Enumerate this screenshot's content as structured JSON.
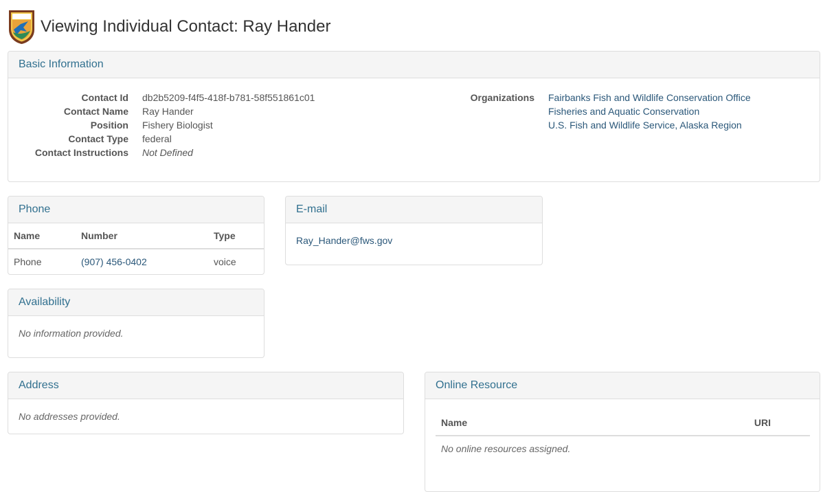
{
  "page": {
    "title": "Viewing Individual Contact: Ray Hander"
  },
  "basic_info": {
    "heading": "Basic Information",
    "fields": [
      {
        "label": "Contact Id",
        "value": "db2b5209-f4f5-418f-b781-58f551861c01"
      },
      {
        "label": "Contact Name",
        "value": "Ray Hander"
      },
      {
        "label": "Position",
        "value": "Fishery Biologist"
      },
      {
        "label": "Contact Type",
        "value": "federal"
      },
      {
        "label": "Contact Instructions",
        "value": "Not Defined"
      }
    ],
    "organizations_label": "Organizations",
    "organizations": [
      "Fairbanks Fish and Wildlife Conservation Office",
      "Fisheries and Aquatic Conservation",
      "U.S. Fish and Wildlife Service, Alaska Region"
    ]
  },
  "phone": {
    "heading": "Phone",
    "columns": [
      "Name",
      "Number",
      "Type"
    ],
    "rows": [
      {
        "name": "Phone",
        "number": "(907) 456-0402",
        "type": "voice"
      }
    ]
  },
  "email": {
    "heading": "E-mail",
    "address": "Ray_Hander@fws.gov"
  },
  "availability": {
    "heading": "Availability",
    "text": "No information provided."
  },
  "address": {
    "heading": "Address",
    "text": "No addresses provided."
  },
  "online_resource": {
    "heading": "Online Resource",
    "columns": [
      "Name",
      "URI"
    ],
    "empty_text": "No online resources assigned."
  },
  "colors": {
    "heading_text": "#31708f",
    "link": "#2a5779",
    "panel_heading_bg": "#f5f5f5",
    "border": "#dddddd"
  }
}
